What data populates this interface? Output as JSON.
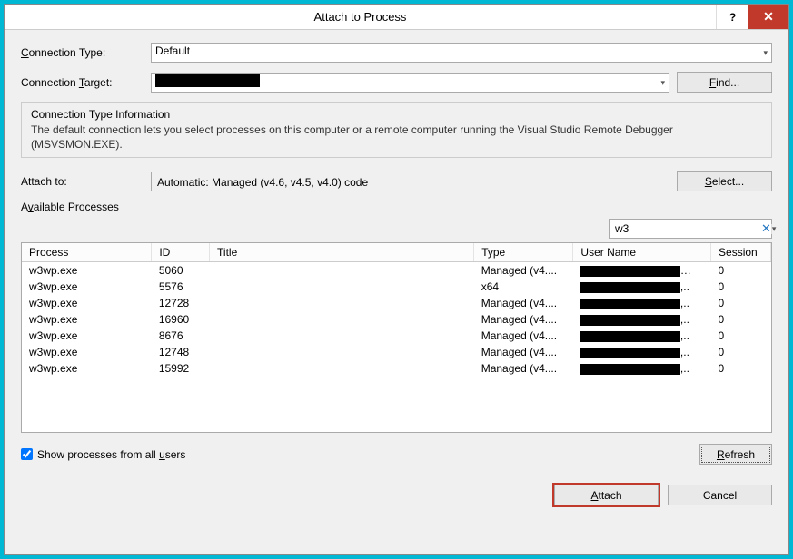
{
  "title": "Attach to Process",
  "connectionType": {
    "label": "Connection Type:",
    "accelChar": "C",
    "value": "Default"
  },
  "connectionTarget": {
    "label": "Connection Target:",
    "accelChar": "T",
    "findLabel": "Find...",
    "findAccel": "F"
  },
  "info": {
    "title": "Connection Type Information",
    "text": "The default connection lets you select processes on this computer or a remote computer running the Visual Studio Remote Debugger (MSVSMON.EXE)."
  },
  "attachTo": {
    "label": "Attach to:",
    "value": "Automatic: Managed (v4.6, v4.5, v4.0) code",
    "selectLabel": "Select...",
    "selectAccel": "S"
  },
  "availableProcesses": {
    "label": "Available Processes",
    "accel": "v",
    "filter": "w3"
  },
  "columns": {
    "process": "Process",
    "id": "ID",
    "title": "Title",
    "type": "Type",
    "user": "User Name",
    "session": "Session"
  },
  "rows": [
    {
      "process": "w3wp.exe",
      "id": "5060",
      "title": "",
      "type": "Managed (v4....",
      "session": "0"
    },
    {
      "process": "w3wp.exe",
      "id": "5576",
      "title": "",
      "type": "x64",
      "session": "0"
    },
    {
      "process": "w3wp.exe",
      "id": "12728",
      "title": "",
      "type": "Managed (v4....",
      "session": "0"
    },
    {
      "process": "w3wp.exe",
      "id": "16960",
      "title": "",
      "type": "Managed (v4....",
      "session": "0"
    },
    {
      "process": "w3wp.exe",
      "id": "8676",
      "title": "",
      "type": "Managed (v4....",
      "session": "0"
    },
    {
      "process": "w3wp.exe",
      "id": "12748",
      "title": "",
      "type": "Managed (v4....",
      "session": "0"
    },
    {
      "process": "w3wp.exe",
      "id": "15992",
      "title": "",
      "type": "Managed (v4....",
      "session": "0"
    }
  ],
  "showAllUsers": {
    "label": "Show processes from all users",
    "accel": "u",
    "checked": true
  },
  "buttons": {
    "refresh": "Refresh",
    "refreshAccel": "R",
    "attach": "Attach",
    "attachAccel": "A",
    "cancel": "Cancel"
  }
}
